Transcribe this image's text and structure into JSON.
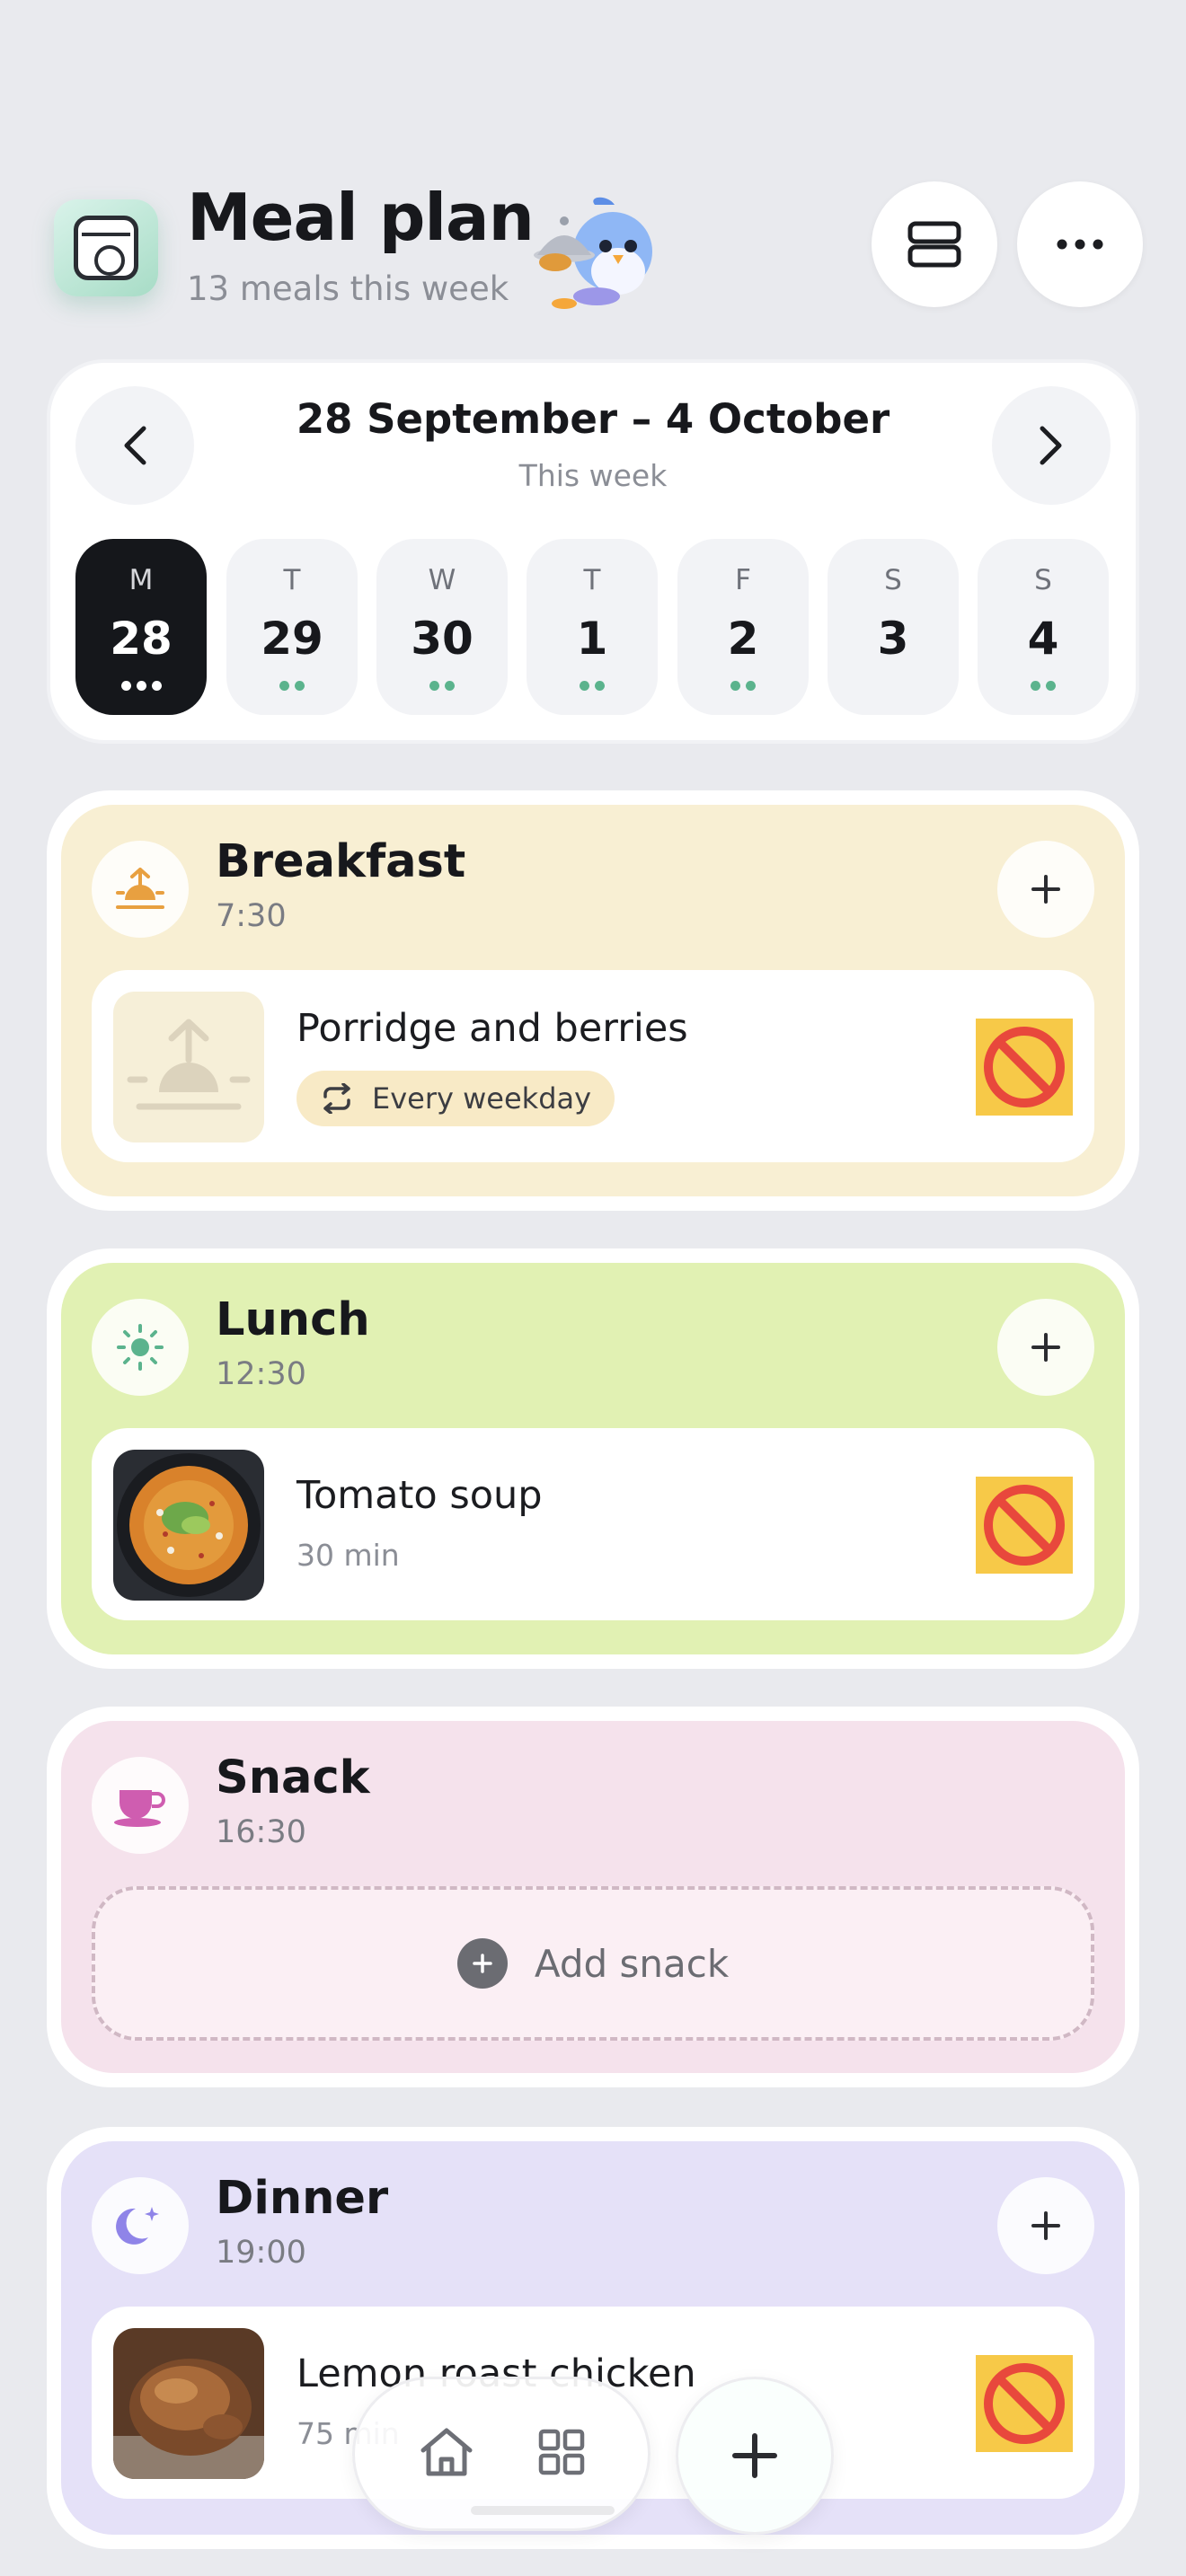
{
  "header": {
    "title": "Meal plan",
    "subtitle": "13 meals this week",
    "icons": {
      "app": "calendar-icon",
      "mascot": "bird-chef-mascot",
      "layout": "layout-rows-icon",
      "more": "more-horizontal-icon"
    }
  },
  "week": {
    "range": "28 September – 4 October",
    "label": "This week",
    "days": [
      {
        "letter": "M",
        "num": "28",
        "dots": 3,
        "active": true
      },
      {
        "letter": "T",
        "num": "29",
        "dots": 2,
        "active": false
      },
      {
        "letter": "W",
        "num": "30",
        "dots": 2,
        "active": false
      },
      {
        "letter": "T",
        "num": "1",
        "dots": 2,
        "active": false
      },
      {
        "letter": "F",
        "num": "2",
        "dots": 2,
        "active": false
      },
      {
        "letter": "S",
        "num": "3",
        "dots": 0,
        "active": false
      },
      {
        "letter": "S",
        "num": "4",
        "dots": 2,
        "active": false
      }
    ]
  },
  "meals": {
    "breakfast": {
      "name": "Breakfast",
      "time": "7:30",
      "icon": "sunrise-icon",
      "item": {
        "title": "Porridge and berries",
        "tag": "Every weekday",
        "tag_icon": "repeat-icon"
      }
    },
    "lunch": {
      "name": "Lunch",
      "time": "12:30",
      "icon": "sun-icon",
      "item": {
        "title": "Tomato soup",
        "meta": "30 min"
      }
    },
    "snack": {
      "name": "Snack",
      "time": "16:30",
      "icon": "teacup-icon",
      "add_label": "Add snack"
    },
    "dinner": {
      "name": "Dinner",
      "time": "19:00",
      "icon": "moon-stars-icon",
      "item": {
        "title": "Lemon roast chicken",
        "meta": "75 min"
      }
    }
  },
  "colors": {
    "breakfast_bg": "#f8efd3",
    "lunch_bg": "#e1f1b3",
    "snack_bg": "#f5e2ec",
    "dinner_bg": "#e5e1f8",
    "accent_green": "#5bb38d",
    "remove": "#e8483c"
  },
  "tabbar": {
    "icons": [
      "home-icon",
      "grid-icon"
    ],
    "fab_icon": "plus-icon"
  }
}
